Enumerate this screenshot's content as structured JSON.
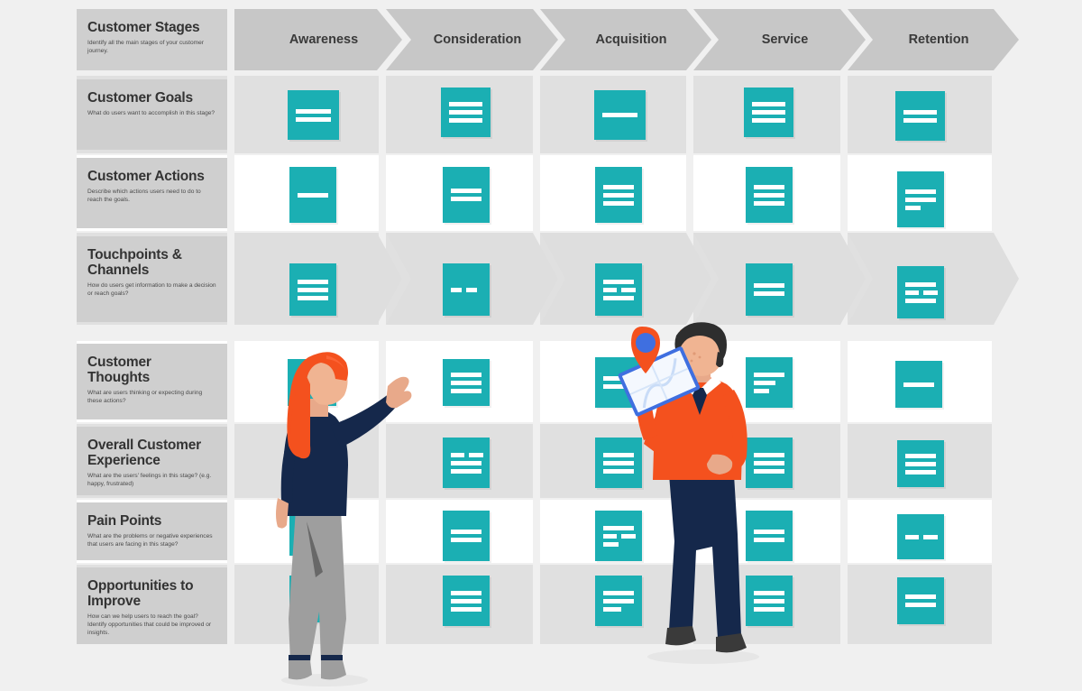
{
  "board": {
    "title_column": {
      "header": {
        "title": "Customer Stages",
        "subtitle": "Identify all the main stages of your customer journey."
      },
      "rows": [
        {
          "title": "Customer Goals",
          "subtitle": "What do users want to accomplish in this stage?"
        },
        {
          "title": "Customer Actions",
          "subtitle": "Describe which actions users need to do to reach the goals."
        },
        {
          "title": "Touchpoints & Channels",
          "subtitle": "How do users get information to make a decision or reach goals?"
        },
        {
          "title": "Customer Thoughts",
          "subtitle": "What are users thinking or expecting during these actions?"
        },
        {
          "title": "Overall Customer Experience",
          "subtitle": "What are the users' feelings in this stage? (e.g. happy, frustrated)"
        },
        {
          "title": "Pain Points",
          "subtitle": "What are the problems or negative experiences that users are facing in this stage?"
        },
        {
          "title": "Opportunities to Improve",
          "subtitle": "How can we help users to reach the goal? Identify opportunities that could be improved or insights."
        }
      ]
    },
    "stages": [
      {
        "label": "Awareness"
      },
      {
        "label": "Consideration"
      },
      {
        "label": "Acquisition"
      },
      {
        "label": "Service"
      },
      {
        "label": "Retention"
      }
    ],
    "colors": {
      "page_background": "#f0f0f0",
      "label_cell": "#cfcfcf",
      "stage_chevron": "#c7c7c7",
      "row_band_gray": "#e0e0e0",
      "row_band_white": "#ffffff",
      "note_teal": "#1bafb3",
      "note_line": "#ffffff",
      "person_a_hair": "#f4511e",
      "person_a_top": "#15284b",
      "person_a_pants": "#9e9e9e",
      "person_b_sweater": "#f4511e",
      "person_b_pants": "#15284b",
      "map_pin_outer": "#f4511e",
      "map_pin_inner": "#3f6fe0"
    },
    "notes": [
      {
        "row": "Customer Goals",
        "stage": "Awareness",
        "lines": 2
      },
      {
        "row": "Customer Goals",
        "stage": "Consideration",
        "lines": 3
      },
      {
        "row": "Customer Goals",
        "stage": "Acquisition",
        "lines": 1
      },
      {
        "row": "Customer Goals",
        "stage": "Service",
        "lines": 3
      },
      {
        "row": "Customer Goals",
        "stage": "Retention",
        "lines": 2
      },
      {
        "row": "Customer Actions",
        "stage": "Awareness",
        "lines": 1
      },
      {
        "row": "Customer Actions",
        "stage": "Consideration",
        "lines": 2
      },
      {
        "row": "Customer Actions",
        "stage": "Acquisition",
        "lines": 3
      },
      {
        "row": "Customer Actions",
        "stage": "Service",
        "lines": 3
      },
      {
        "row": "Customer Actions",
        "stage": "Retention",
        "lines": 3
      },
      {
        "row": "Touchpoints & Channels",
        "stage": "Awareness",
        "lines": 3
      },
      {
        "row": "Touchpoints & Channels",
        "stage": "Consideration",
        "lines": 1
      },
      {
        "row": "Touchpoints & Channels",
        "stage": "Acquisition",
        "lines": 3
      },
      {
        "row": "Touchpoints & Channels",
        "stage": "Service",
        "lines": 2
      },
      {
        "row": "Touchpoints & Channels",
        "stage": "Retention",
        "lines": 3
      },
      {
        "row": "Customer Thoughts",
        "stage": "Awareness",
        "lines": 1
      },
      {
        "row": "Customer Thoughts",
        "stage": "Consideration",
        "lines": 3
      },
      {
        "row": "Customer Thoughts",
        "stage": "Acquisition",
        "lines": 2
      },
      {
        "row": "Customer Thoughts",
        "stage": "Service",
        "lines": 3
      },
      {
        "row": "Customer Thoughts",
        "stage": "Retention",
        "lines": 1
      },
      {
        "row": "Overall Customer Experience",
        "stage": "Awareness",
        "lines": 2
      },
      {
        "row": "Overall Customer Experience",
        "stage": "Consideration",
        "lines": 3
      },
      {
        "row": "Overall Customer Experience",
        "stage": "Acquisition",
        "lines": 3
      },
      {
        "row": "Overall Customer Experience",
        "stage": "Service",
        "lines": 3
      },
      {
        "row": "Overall Customer Experience",
        "stage": "Retention",
        "lines": 3
      },
      {
        "row": "Pain Points",
        "stage": "Awareness",
        "lines": 2
      },
      {
        "row": "Pain Points",
        "stage": "Consideration",
        "lines": 2
      },
      {
        "row": "Pain Points",
        "stage": "Acquisition",
        "lines": 3
      },
      {
        "row": "Pain Points",
        "stage": "Service",
        "lines": 2
      },
      {
        "row": "Pain Points",
        "stage": "Retention",
        "lines": 1
      },
      {
        "row": "Opportunities to Improve",
        "stage": "Awareness",
        "lines": 2
      },
      {
        "row": "Opportunities to Improve",
        "stage": "Consideration",
        "lines": 3
      },
      {
        "row": "Opportunities to Improve",
        "stage": "Acquisition",
        "lines": 3
      },
      {
        "row": "Opportunities to Improve",
        "stage": "Service",
        "lines": 3
      },
      {
        "row": "Opportunities to Improve",
        "stage": "Retention",
        "lines": 2
      }
    ],
    "illustrations": [
      {
        "name": "woman-pointing-at-board"
      },
      {
        "name": "man-holding-map"
      }
    ]
  }
}
